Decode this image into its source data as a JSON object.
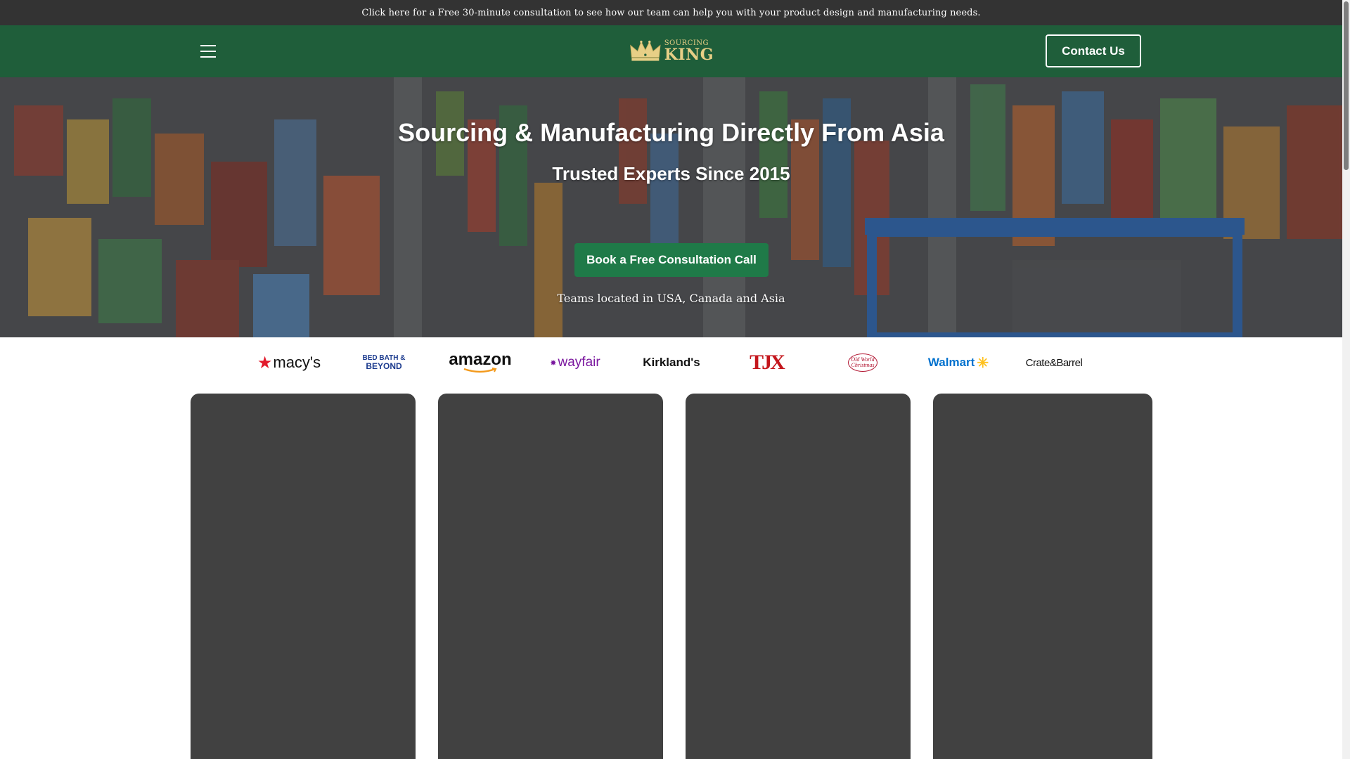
{
  "announcement": {
    "text": "Click here for a Free 30-minute consultation to see how our team can help you with your product design and manufacturing needs."
  },
  "header": {
    "menu_icon": "hamburger-menu-icon",
    "logo": {
      "small": "SOURCING",
      "big": "KING"
    },
    "contact_label": "Contact Us"
  },
  "hero": {
    "title": "Sourcing & Manufacturing Directly From Asia",
    "subtitle": "Trusted Experts Since 2015",
    "cta_label": "Book a Free Consultation Call",
    "note": "Teams located in USA, Canada and Asia"
  },
  "brands": {
    "macys": "macy's",
    "bbb_line1": "BED BATH &",
    "bbb_line2": "BEYOND",
    "amazon": "amazon",
    "wayfair": "wayfair",
    "kirklands": "Kirkland's",
    "tjx": "TJX",
    "oldworld_line1": "Old World",
    "oldworld_line2": "Christmas",
    "walmart": "Walmart",
    "crate": "Crate&Barrel"
  },
  "colors": {
    "announcement_bg": "#333333",
    "header_bg": "#1f5e3a",
    "cta_bg": "#1f7a48",
    "card_bg": "#414141",
    "logo_gold": "#e7cf86"
  }
}
